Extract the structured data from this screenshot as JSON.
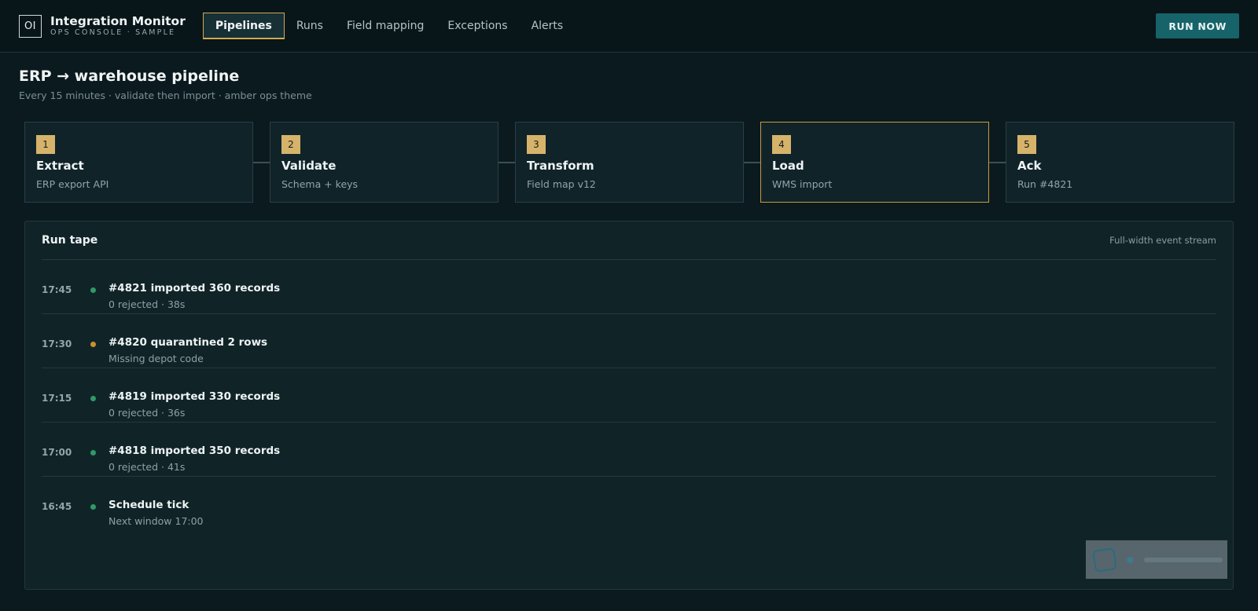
{
  "header": {
    "logo": "OI",
    "app_title": "Integration Monitor",
    "app_subtitle": "OPS CONSOLE · SAMPLE",
    "nav": [
      {
        "label": "Pipelines",
        "active": true
      },
      {
        "label": "Runs",
        "active": false
      },
      {
        "label": "Field mapping",
        "active": false
      },
      {
        "label": "Exceptions",
        "active": false
      },
      {
        "label": "Alerts",
        "active": false
      }
    ],
    "run_now": "RUN NOW"
  },
  "page": {
    "title": "ERP → warehouse pipeline",
    "subtitle": "Every 15 minutes · validate then import · amber ops theme"
  },
  "steps": [
    {
      "num": "1",
      "title": "Extract",
      "desc": "ERP export API",
      "active": false
    },
    {
      "num": "2",
      "title": "Validate",
      "desc": "Schema + keys",
      "active": false
    },
    {
      "num": "3",
      "title": "Transform",
      "desc": "Field map v12",
      "active": false
    },
    {
      "num": "4",
      "title": "Load",
      "desc": "WMS import",
      "active": true
    },
    {
      "num": "5",
      "title": "Ack",
      "desc": "Run #4821",
      "active": false
    }
  ],
  "tape": {
    "title": "Run tape",
    "note": "Full-width event stream",
    "events": [
      {
        "time": "17:45",
        "status": "success",
        "title": "#4821 imported 360 records",
        "detail": "0 rejected · 38s"
      },
      {
        "time": "17:30",
        "status": "warning",
        "title": "#4820 quarantined 2 rows",
        "detail": "Missing depot code"
      },
      {
        "time": "17:15",
        "status": "success",
        "title": "#4819 imported 330 records",
        "detail": "0 rejected · 36s"
      },
      {
        "time": "17:00",
        "status": "success",
        "title": "#4818 imported 350 records",
        "detail": "0 rejected · 41s"
      },
      {
        "time": "16:45",
        "status": "success",
        "title": "Schedule tick",
        "detail": "Next window 17:00"
      }
    ]
  },
  "colors": {
    "accent_amber": "#d6b36b",
    "primary_teal": "#17636a",
    "status_success": "#2f9a66",
    "status_warning": "#c8902f"
  }
}
